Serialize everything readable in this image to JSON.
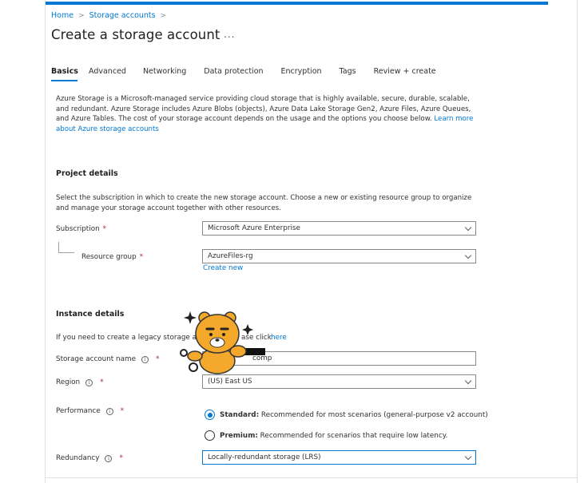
{
  "breadcrumb": {
    "items": [
      "Home",
      "Storage accounts"
    ],
    "separator": ">"
  },
  "page": {
    "title": "Create a storage account",
    "more": "..."
  },
  "tabs": [
    "Basics",
    "Advanced",
    "Networking",
    "Data protection",
    "Encryption",
    "Tags",
    "Review + create"
  ],
  "active_tab": "Basics",
  "intro": {
    "text": "Azure Storage is a Microsoft-managed service providing cloud storage that is highly available, secure, durable, scalable, and redundant. Azure Storage includes Azure Blobs (objects), Azure Data Lake Storage Gen2, Azure Files, Azure Queues, and Azure Tables. The cost of your storage account depends on the usage and the options you choose below. ",
    "link": "Learn more about Azure storage accounts"
  },
  "project": {
    "heading": "Project details",
    "description": "Select the subscription in which to create the new storage account. Choose a new or existing resource group to organize and manage your storage account together with other resources.",
    "subscription_label": "Subscription",
    "subscription_value": "Microsoft Azure Enterprise",
    "resource_group_label": "Resource group",
    "resource_group_value": "AzureFiles-rg",
    "create_new": "Create new"
  },
  "instance": {
    "heading": "Instance details",
    "legacy_text": "If you need to create a legacy storage a",
    "legacy_text_end": "ase click ",
    "legacy_link": "here",
    "name_label": "Storage account name",
    "name_value": "comp",
    "region_label": "Region",
    "region_value": "(US) East US",
    "performance_label": "Performance",
    "standard_label": "Standard:",
    "standard_desc": " Recommended for most scenarios (general-purpose v2 account)",
    "premium_label": "Premium:",
    "premium_desc": " Recommended for scenarios that require low latency.",
    "redundancy_label": "Redundancy",
    "redundancy_value": "Locally-redundant storage (LRS)"
  },
  "required_mark": "*",
  "info_glyph": "i",
  "icons": [
    "info-icon",
    "chevron-down-icon",
    "more-icon",
    "mascot-sticker"
  ],
  "colors": {
    "accent": "#0078d4",
    "text": "#323130",
    "required": "#a4262c",
    "mascot": "#f4a82c"
  }
}
